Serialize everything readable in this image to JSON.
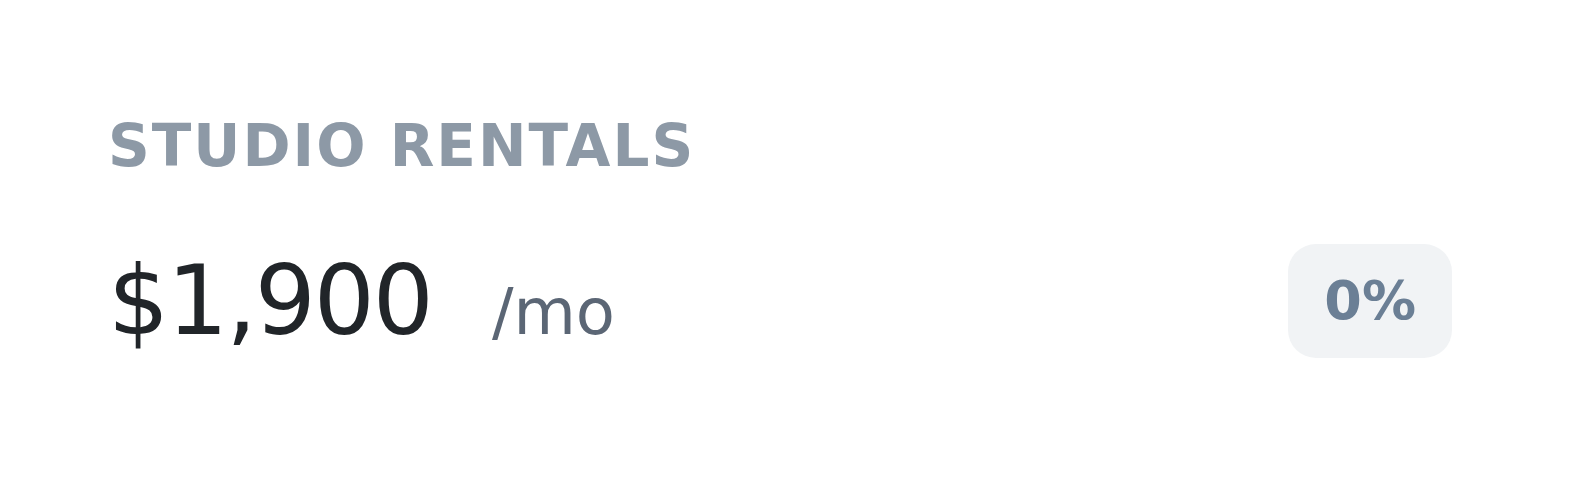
{
  "stat": {
    "label": "STUDIO RENTALS",
    "value": "$1,900",
    "unit": "/mo",
    "change": "0%"
  }
}
